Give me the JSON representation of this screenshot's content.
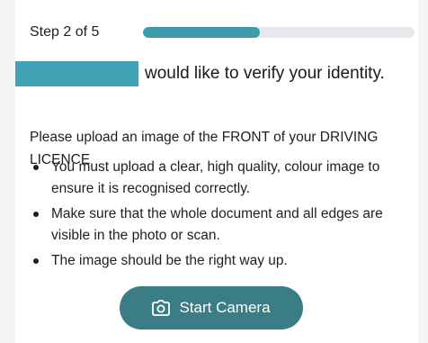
{
  "progress": {
    "step_label": "Step 2 of 5",
    "current_step": 2,
    "total_steps": 5,
    "fill_fraction": 0.43
  },
  "heading": {
    "text": "would like to verify your identity."
  },
  "instructions": {
    "intro": "Please upload an image of the FRONT of your DRIVING LICENCE",
    "bullets": [
      "You must upload a clear, high quality, colour image to ensure it is recognised correctly.",
      "Make sure that the whole document and all edges are visible in the photo or scan.",
      "The image should be the right way up."
    ]
  },
  "camera_button": {
    "label": "Start Camera",
    "icon": "camera-icon"
  },
  "colors": {
    "accent": "#3d9bb0",
    "redaction": "#3fa3b5",
    "button": "#3a7d86",
    "track": "#e8e8ec"
  }
}
